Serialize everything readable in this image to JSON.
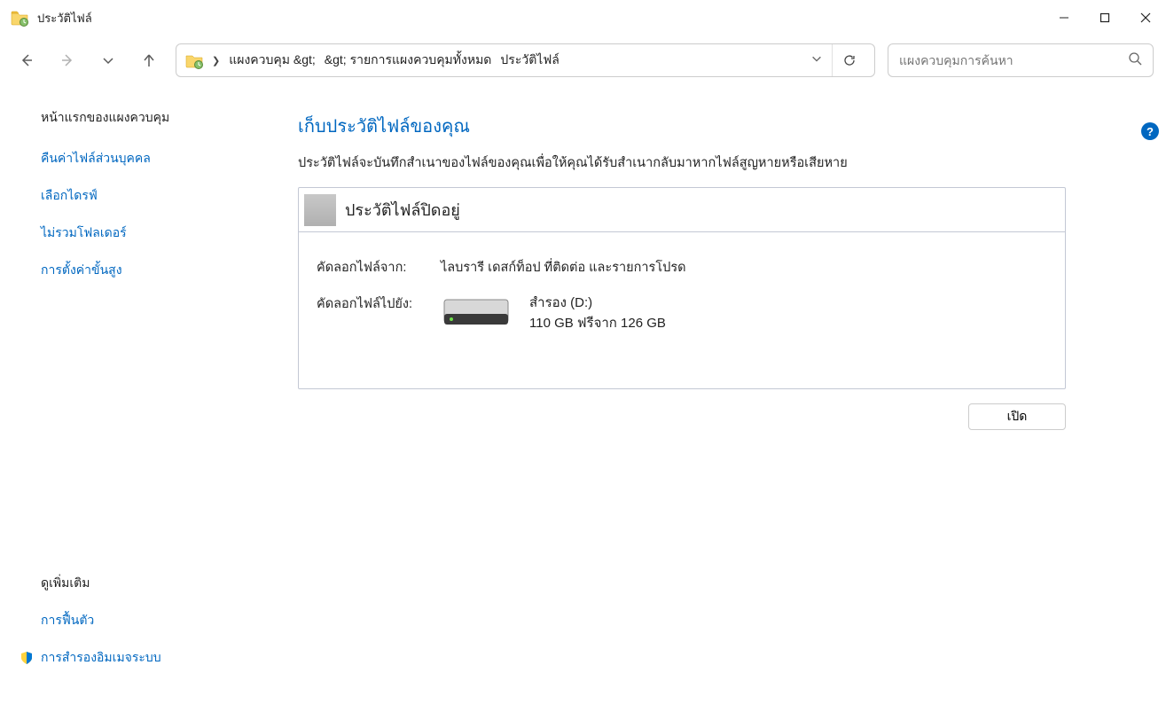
{
  "window": {
    "title": "ประวัติไฟล์"
  },
  "breadcrumb": {
    "part1": "แผงควบคุม &gt;",
    "part2": "&gt; รายการแผงควบคุมทั้งหมด",
    "part3": "ประวัติไฟล์"
  },
  "search": {
    "placeholder": "แผงควบคุมการค้นหา"
  },
  "sidebar": {
    "home": "หน้าแรกของแผงควบคุม",
    "links": {
      "restore": "คืนค่าไฟล์ส่วนบุคคล",
      "select_drive": "เลือกไดรฟ์",
      "exclude": "ไม่รวมโฟลเดอร์",
      "advanced": "การตั้งค่าขั้นสูง"
    },
    "footer": {
      "see_more": "ดูเพิ่มเติม",
      "recovery": "การฟื้นตัว",
      "system_image": "การสำรองอิมเมจระบบ"
    }
  },
  "content": {
    "heading": "เก็บประวัติไฟล์ของคุณ",
    "sub": "ประวัติไฟล์จะบันทึกสำเนาของไฟล์ของคุณเพื่อให้คุณได้รับสำเนากลับมาหากไฟล์สูญหายหรือเสียหาย",
    "panel_title": "ประวัติไฟล์ปิดอยู่",
    "copy_from_label": "คัดลอกไฟล์จาก:",
    "copy_from_value": "ไลบรารี เดสก์ท็อป ที่ติดต่อ และรายการโปรด",
    "copy_to_label": "คัดลอกไฟล์ไปยัง:",
    "drive_name": "สำรอง (D:)",
    "drive_free": "110 GB ฟรีจาก 126   GB",
    "open_button": "เปิด"
  }
}
